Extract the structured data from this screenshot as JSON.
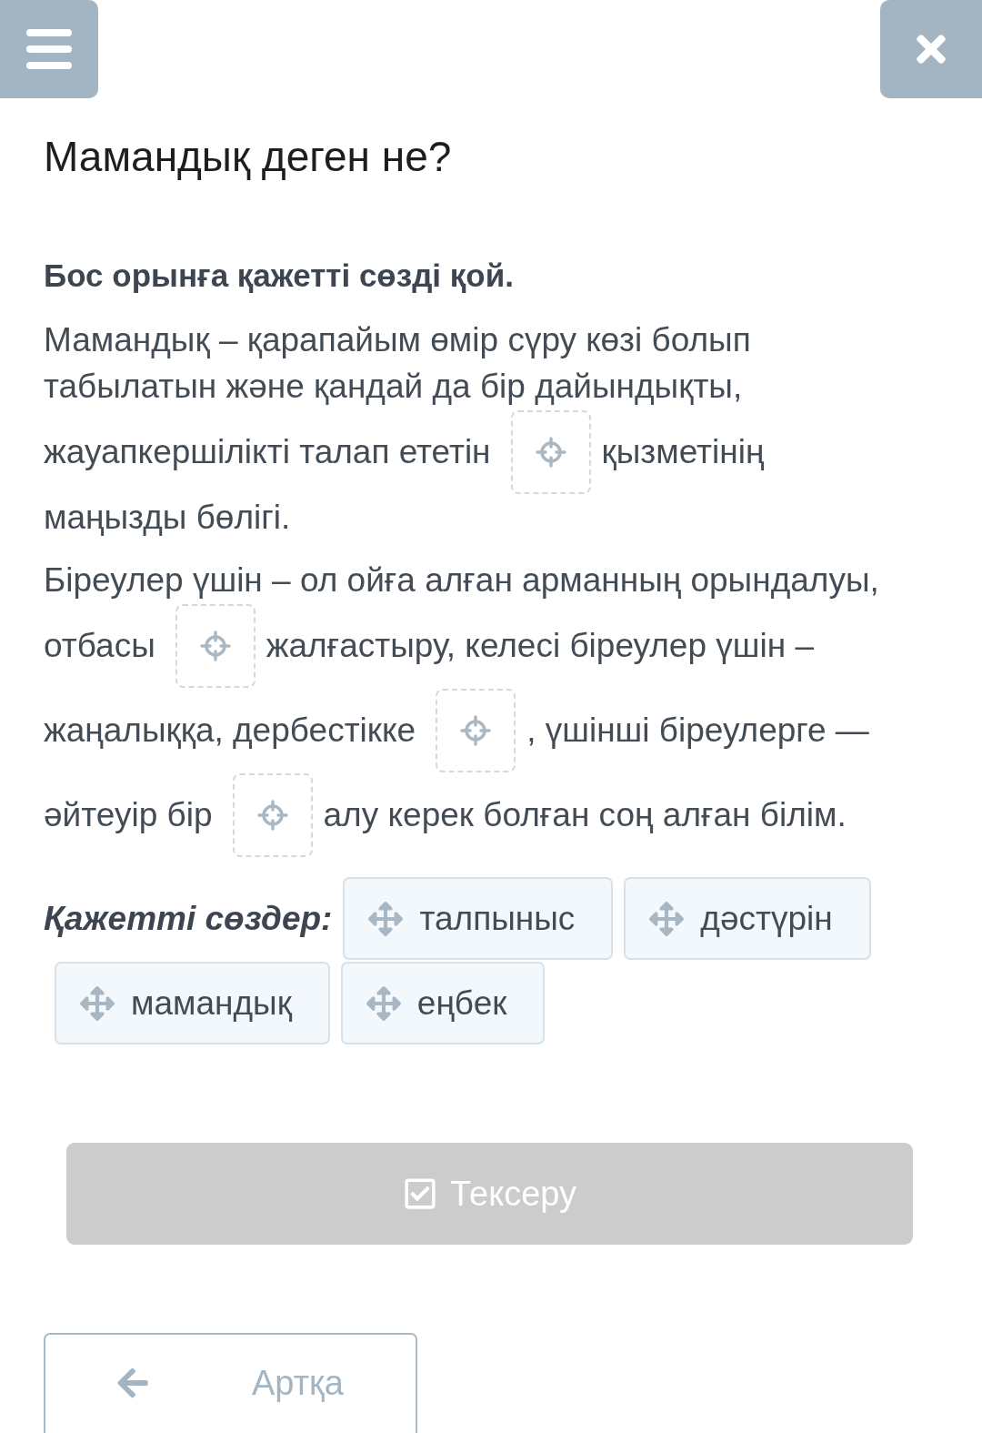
{
  "title": "Мамандық деген не?",
  "instruction": "Бос орынға қажетті сөзді қой.",
  "passage": [
    {
      "lines": [
        [
          {
            "kind": "text",
            "text": "Мамандық – қарапайым өмір сүру көзі болып"
          }
        ],
        [
          {
            "kind": "text",
            "text": "табылатын және қандай да бір дайындықты,"
          }
        ],
        [
          {
            "kind": "text",
            "text": "жауапкершілікті талап ететін"
          },
          {
            "kind": "blank"
          },
          {
            "kind": "text",
            "text": "қызметінің"
          }
        ],
        [
          {
            "kind": "text",
            "text": "маңызды бөлігі."
          }
        ]
      ]
    },
    {
      "lines": [
        [
          {
            "kind": "text",
            "text": "Біреулер үшін – ол ойға алған арманның орындалуы,"
          }
        ],
        [
          {
            "kind": "text",
            "text": "отбасы"
          },
          {
            "kind": "blank"
          },
          {
            "kind": "text",
            "text": "жалғастыру, келесі біреулер үшін –"
          }
        ],
        [
          {
            "kind": "text",
            "text": "жаңалыққа, дербестікке"
          },
          {
            "kind": "blank"
          },
          {
            "kind": "text",
            "text": ", үшінші біреулерге —"
          }
        ],
        [
          {
            "kind": "text",
            "text": "әйтеуір бір"
          },
          {
            "kind": "blank"
          },
          {
            "kind": "text",
            "text": "алу керек болған соң алған білім."
          }
        ]
      ]
    }
  ],
  "word_bank": {
    "label": "Қажетті сөздер:",
    "words": [
      "талпыныс",
      "дәстүрін",
      "мамандық",
      "еңбек"
    ]
  },
  "check_button": {
    "label": "Тексеру",
    "disabled": true
  },
  "back_button": {
    "label": "Артқа"
  }
}
